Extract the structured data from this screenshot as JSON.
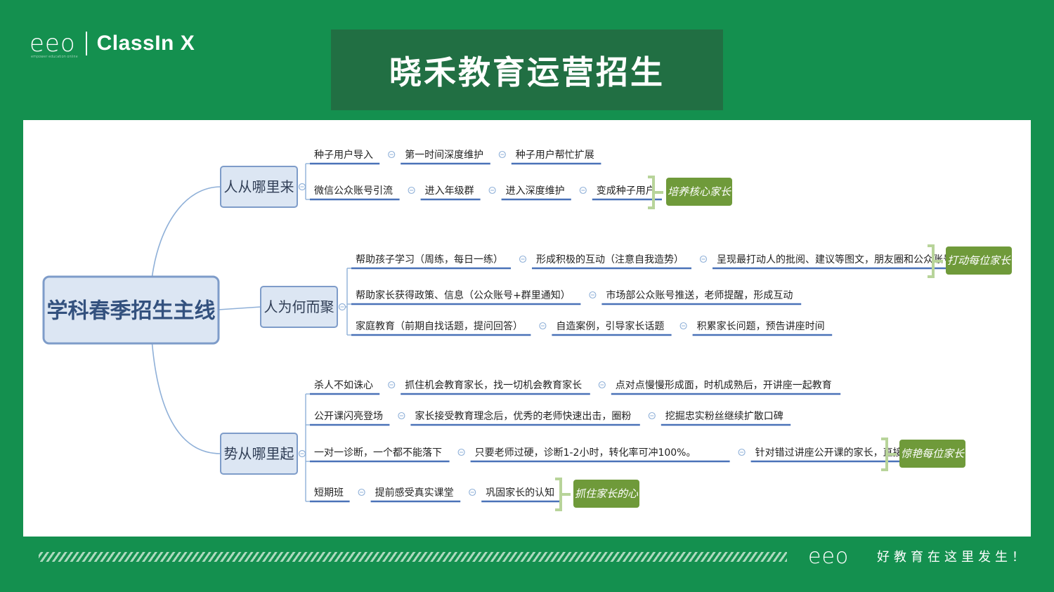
{
  "header": {
    "logo_text": "eeo",
    "logo_subtext": "empower education online",
    "brand": "ClassIn X",
    "title": "晓禾教育运营招生"
  },
  "footer": {
    "logo_text": "eeo",
    "slogan": "好教育在这里发生！"
  },
  "colors": {
    "background": "#14904f",
    "title_box": "#216f43",
    "node_fill": "#dce6f3",
    "node_border": "#7e9cc9",
    "connector": "#8fb0d8",
    "underline": "#4a72b8",
    "tag_fill": "#6f9a3a",
    "bracket": "#b8d49a"
  },
  "mindmap": {
    "root": "学科春季招生主线",
    "branches": [
      {
        "label": "人从哪里来",
        "rows": [
          {
            "items": [
              "种子用户导入",
              "第一时间深度维护",
              "种子用户帮忙扩展"
            ],
            "tag": ""
          },
          {
            "items": [
              "微信公众账号引流",
              "进入年级群",
              "进入深度维护",
              "变成种子用户"
            ],
            "tag": "培养核心家长"
          }
        ]
      },
      {
        "label": "人为何而聚",
        "rows": [
          {
            "items": [
              "帮助孩子学习（周练，每日一练）",
              "形成积极的互动（注意自我造势）",
              "呈现最打动人的批阅、建议等图文，朋友圈和公众账号推送"
            ],
            "tag": "打动每位家长"
          },
          {
            "items": [
              "帮助家长获得政策、信息（公众账号+群里通知）",
              "市场部公众账号推送，老师提醒，形成互动"
            ],
            "tag": ""
          },
          {
            "items": [
              "家庭教育（前期自找话题，提问回答）",
              "自造案例，引导家长话题",
              "积累家长问题，预告讲座时间"
            ],
            "tag": ""
          }
        ]
      },
      {
        "label": "势从哪里起",
        "rows": [
          {
            "items": [
              "杀人不如诛心",
              "抓住机会教育家长，找一切机会教育家长",
              "点对点慢慢形成面，时机成熟后，开讲座一起教育"
            ],
            "tag": ""
          },
          {
            "items": [
              "公开课闪亮登场",
              "家长接受教育理念后，优秀的老师快速出击，圈粉",
              "挖掘忠实粉丝继续扩散口碑"
            ],
            "tag": ""
          },
          {
            "items": [
              "一对一诊断，一个都不能落下",
              "只要老师过硬，诊断1-2小时，转化率可冲100%。",
              "针对错过讲座公开课的家长，直接用老师吸引"
            ],
            "tag": "惊艳每位家长"
          },
          {
            "items": [
              "短期班",
              "提前感受真实课堂",
              "巩固家长的认知"
            ],
            "tag": "抓住家长的心"
          }
        ]
      }
    ]
  }
}
